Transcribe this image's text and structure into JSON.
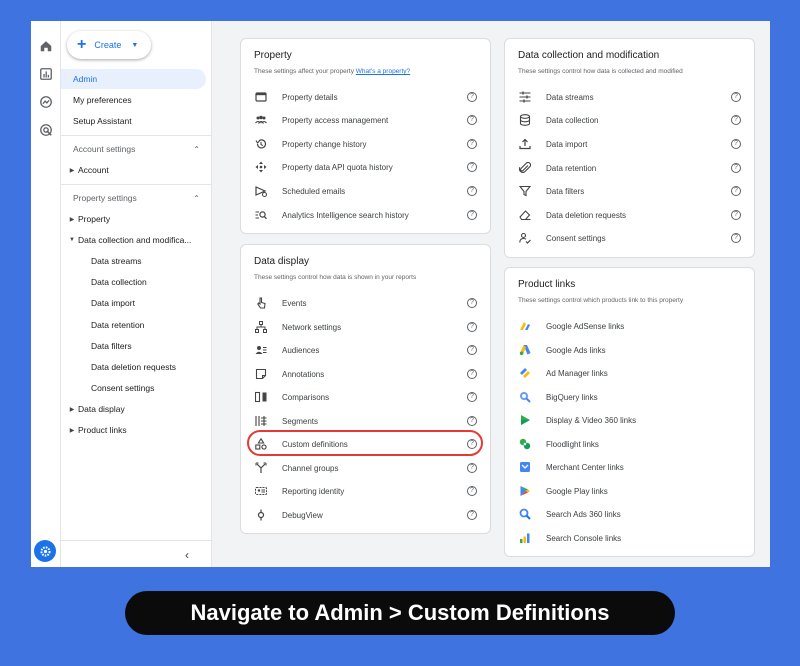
{
  "sidebar": {
    "create_label": "Create",
    "items": [
      {
        "label": "Admin",
        "active": true
      },
      {
        "label": "My preferences"
      },
      {
        "label": "Setup Assistant"
      }
    ],
    "account_section": "Account settings",
    "account_item": "Account",
    "property_section": "Property settings",
    "property_item": "Property",
    "data_collection_item": "Data collection and modifica...",
    "data_collection_children": [
      "Data streams",
      "Data collection",
      "Data import",
      "Data retention",
      "Data filters",
      "Data deletion requests",
      "Consent settings"
    ],
    "data_display_item": "Data display",
    "product_links_item": "Product links"
  },
  "property_card": {
    "title": "Property",
    "subtitle": "These settings affect your property",
    "subtitle_link": "What's a property?",
    "items": [
      {
        "label": "Property details",
        "icon": "card-icon"
      },
      {
        "label": "Property access management",
        "icon": "people-icon"
      },
      {
        "label": "Property change history",
        "icon": "history-icon"
      },
      {
        "label": "Property data API quota history",
        "icon": "quota-icon"
      },
      {
        "label": "Scheduled emails",
        "icon": "email-icon"
      },
      {
        "label": "Analytics Intelligence search history",
        "icon": "search-history-icon"
      }
    ]
  },
  "data_display_card": {
    "title": "Data display",
    "subtitle": "These settings control how data is shown in your reports",
    "items": [
      {
        "label": "Events",
        "icon": "tap-icon"
      },
      {
        "label": "Network settings",
        "icon": "network-icon"
      },
      {
        "label": "Audiences",
        "icon": "audiences-icon"
      },
      {
        "label": "Annotations",
        "icon": "annotation-icon"
      },
      {
        "label": "Comparisons",
        "icon": "comparison-icon"
      },
      {
        "label": "Segments",
        "icon": "segments-icon"
      },
      {
        "label": "Custom definitions",
        "icon": "shapes-icon"
      },
      {
        "label": "Channel groups",
        "icon": "channel-icon"
      },
      {
        "label": "Reporting identity",
        "icon": "identity-icon"
      },
      {
        "label": "DebugView",
        "icon": "debug-icon"
      }
    ]
  },
  "data_collection_card": {
    "title": "Data collection and modification",
    "subtitle": "These settings control how data is collected and modified",
    "items": [
      {
        "label": "Data streams",
        "icon": "streams-icon"
      },
      {
        "label": "Data collection",
        "icon": "database-icon"
      },
      {
        "label": "Data import",
        "icon": "upload-icon"
      },
      {
        "label": "Data retention",
        "icon": "attachment-icon"
      },
      {
        "label": "Data filters",
        "icon": "filter-icon"
      },
      {
        "label": "Data deletion requests",
        "icon": "eraser-icon"
      },
      {
        "label": "Consent settings",
        "icon": "consent-icon"
      }
    ]
  },
  "product_links_card": {
    "title": "Product links",
    "subtitle": "These settings control which products link to this property",
    "items": [
      {
        "label": "Google AdSense links",
        "icon": "adsense-icon"
      },
      {
        "label": "Google Ads links",
        "icon": "google-ads-icon"
      },
      {
        "label": "Ad Manager links",
        "icon": "ad-manager-icon"
      },
      {
        "label": "BigQuery links",
        "icon": "bigquery-icon"
      },
      {
        "label": "Display & Video 360 links",
        "icon": "dv360-icon"
      },
      {
        "label": "Floodlight links",
        "icon": "floodlight-icon"
      },
      {
        "label": "Merchant Center links",
        "icon": "merchant-center-icon"
      },
      {
        "label": "Google Play links",
        "icon": "google-play-icon"
      },
      {
        "label": "Search Ads 360 links",
        "icon": "search-ads-icon"
      },
      {
        "label": "Search Console links",
        "icon": "search-console-icon"
      }
    ]
  },
  "caption": "Navigate to Admin > Custom Definitions",
  "colors": {
    "background": "#3f73e0",
    "accent": "#1a73e8",
    "highlight": "#e53935"
  }
}
